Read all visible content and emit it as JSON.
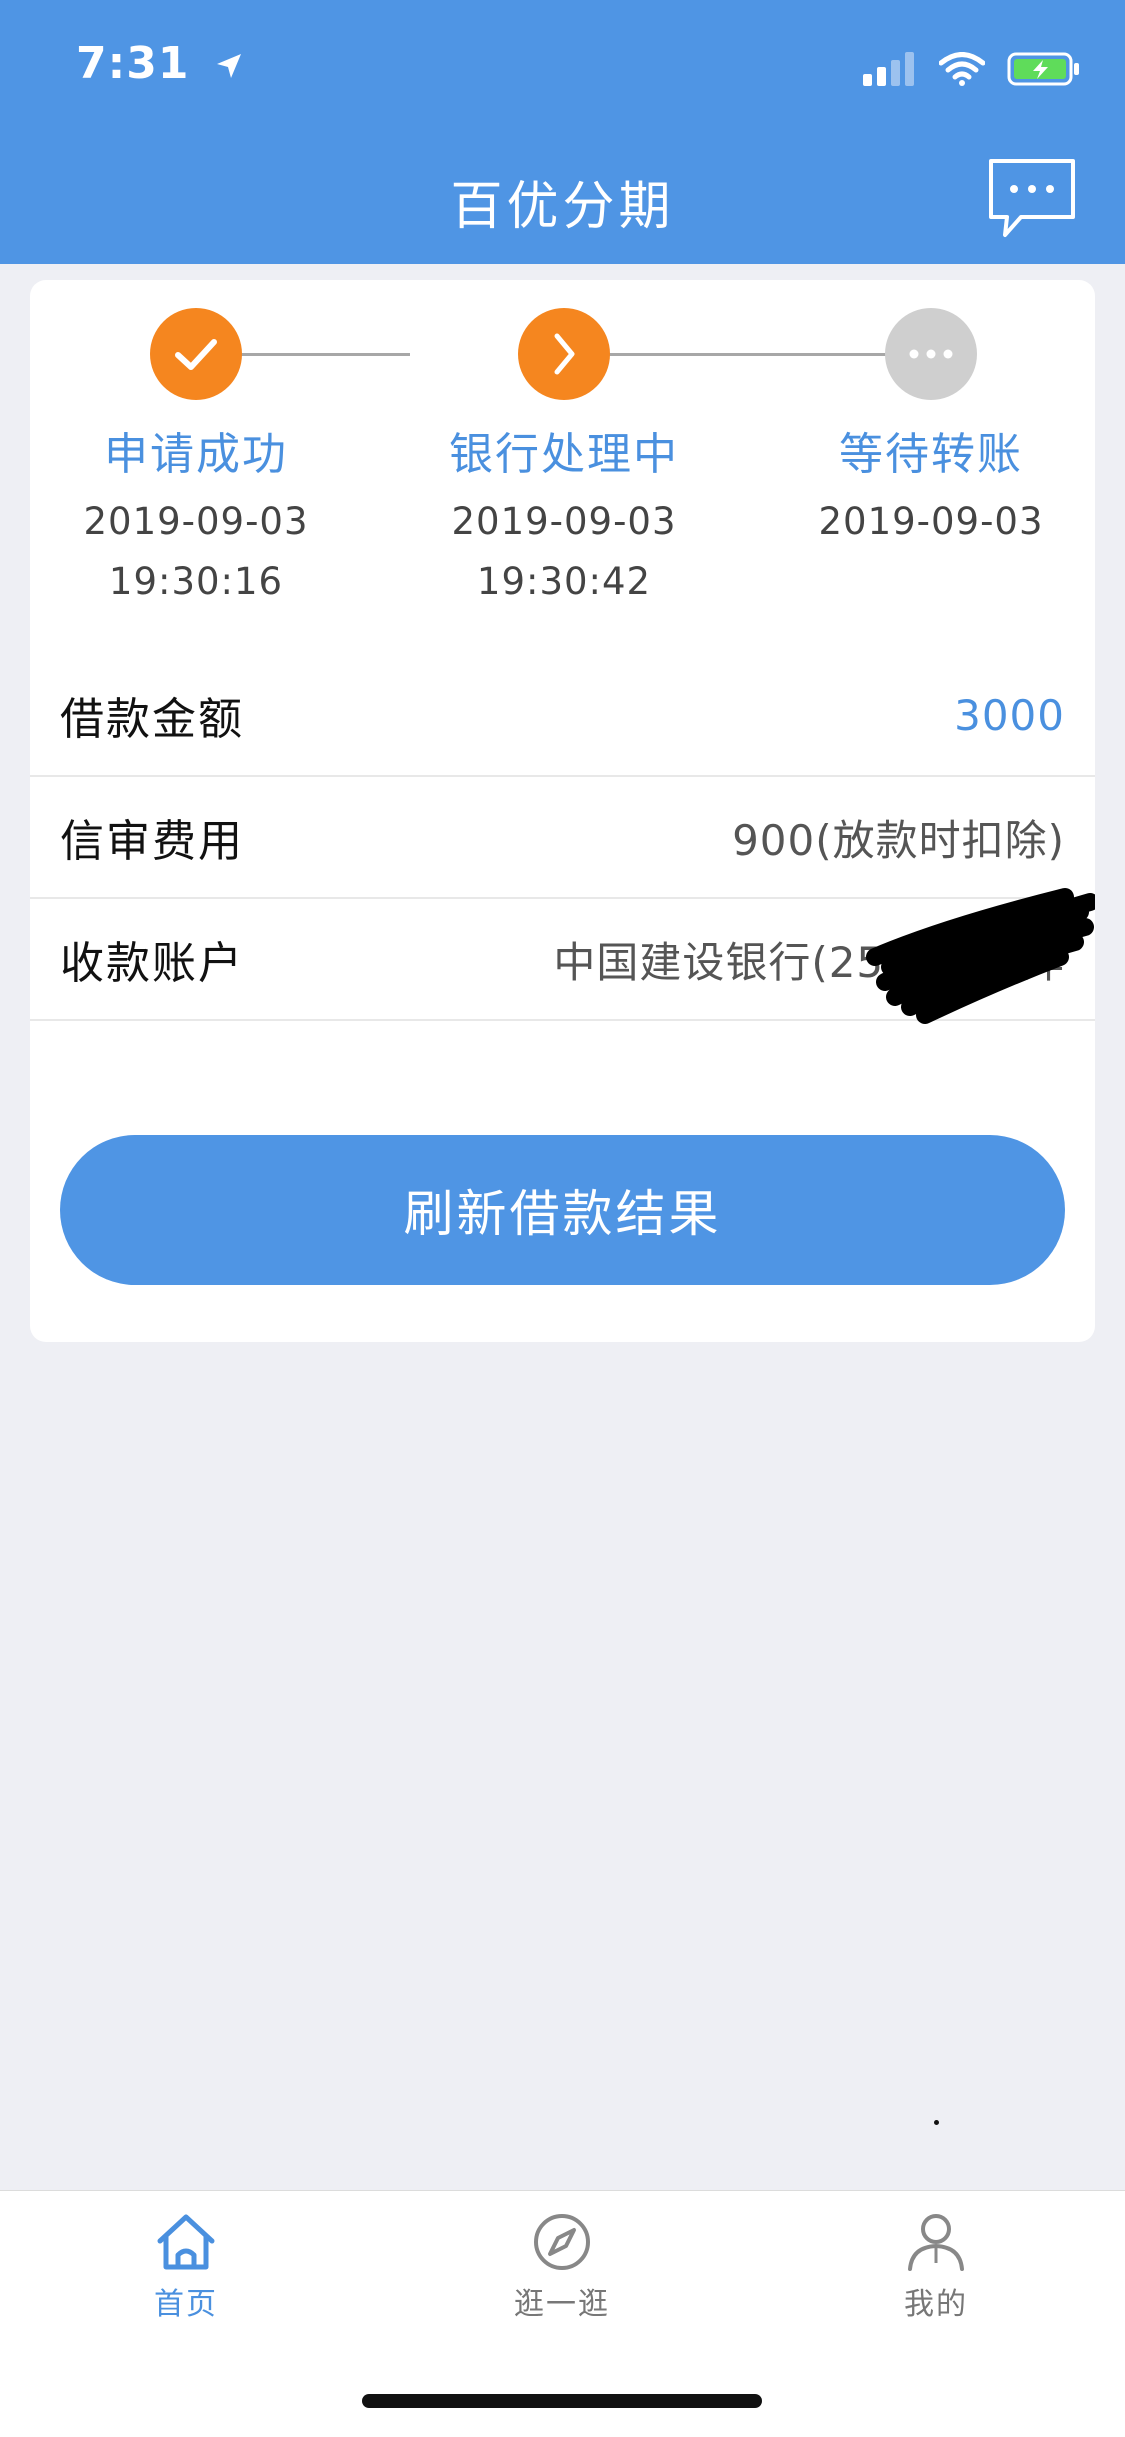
{
  "status_bar": {
    "time": "7:31"
  },
  "header": {
    "title": "百优分期"
  },
  "steps": [
    {
      "label": "申请成功",
      "date": "2019-09-03",
      "time": "19:30:16",
      "state": "done",
      "color": "#f5861f"
    },
    {
      "label": "银行处理中",
      "date": "2019-09-03",
      "time": "19:30:42",
      "state": "current",
      "color": "#f5861f"
    },
    {
      "label": "等待转账",
      "date": "2019-09-03",
      "time": "",
      "state": "pending",
      "color": "#cfcfcf"
    }
  ],
  "details": [
    {
      "label": "借款金额",
      "value": "3000"
    },
    {
      "label": "信审费用",
      "value": "900(放款时扣除)"
    },
    {
      "label": "收款账户",
      "value": "中国建设银行(2556)*聪萍"
    }
  ],
  "refresh_button": "刷新借款结果",
  "tabbar": [
    {
      "label": "首页",
      "icon": "home-icon",
      "active": true
    },
    {
      "label": "逛一逛",
      "icon": "compass-icon",
      "active": false
    },
    {
      "label": "我的",
      "icon": "user-icon",
      "active": false
    }
  ],
  "colors": {
    "accent": "#4f95e4",
    "step_active": "#f5861f",
    "step_pending": "#cfcfcf"
  }
}
